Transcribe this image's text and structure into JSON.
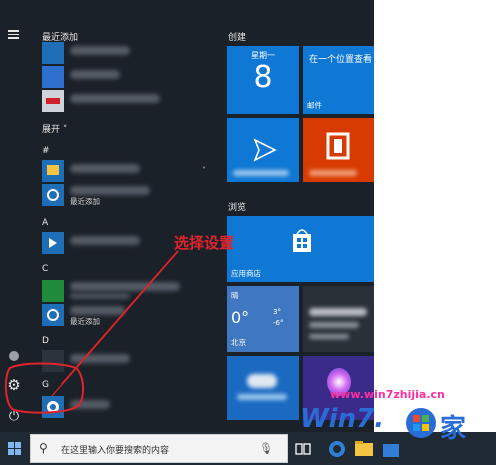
{
  "start_menu": {
    "applist": {
      "recent_header": "最近添加",
      "expand_label": "展开",
      "letters": [
        "#",
        "A",
        "C",
        "D",
        "G"
      ],
      "recently_added_sub": "最近添加"
    },
    "tiles": {
      "group_create": "创建",
      "group_browse": "浏览",
      "calendar": {
        "weekday": "星期一",
        "day": "8"
      },
      "mail": {
        "headline": "在一个位置查看",
        "caption": "邮件"
      },
      "store": {
        "caption": "应用商店"
      },
      "weather": {
        "condition": "晴",
        "temp": "0°",
        "high": "3°",
        "low": "-6°",
        "city": "北京"
      }
    }
  },
  "taskbar": {
    "search_placeholder": "在这里输入你要搜索的内容"
  },
  "annotation": {
    "text": "选择设置",
    "color": "#e0242b"
  },
  "watermark": {
    "url": "www.win7zhijia.cn"
  },
  "colors": {
    "start_bg": "#1b2128",
    "tile_blue": "#0f78d4",
    "office_orange": "#d83b01",
    "taskbar": "#1f2a35"
  }
}
